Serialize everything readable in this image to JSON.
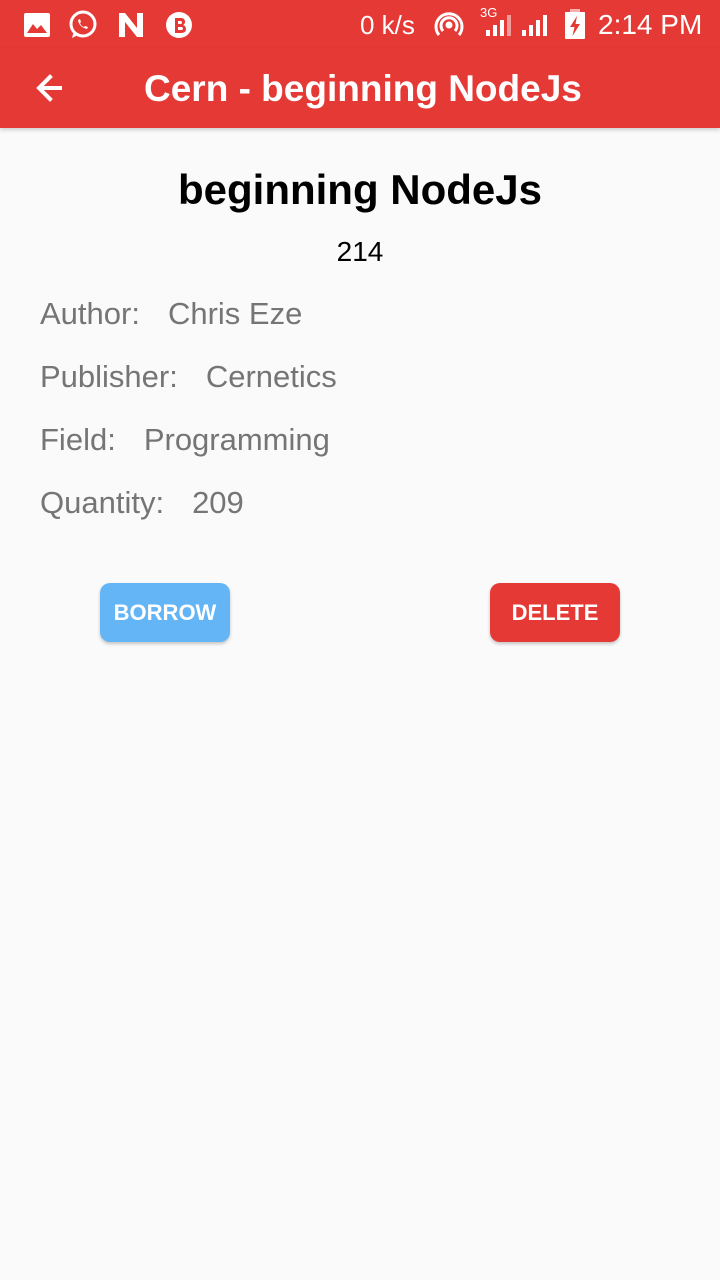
{
  "status_bar": {
    "net_speed": "0 k/s",
    "network_type": "3G",
    "time": "2:14 PM",
    "icons": [
      "gallery-icon",
      "whatsapp-icon",
      "n-app-icon",
      "b-app-icon",
      "hotspot-icon",
      "signal-icon",
      "signal-icon-2",
      "battery-charging-icon"
    ]
  },
  "app_bar": {
    "title": "Cern - beginning NodeJs",
    "back_icon": "arrow-left-icon"
  },
  "book": {
    "title": "beginning NodeJs",
    "id": "214",
    "author_label": "Author:",
    "author": "Chris Eze",
    "publisher_label": "Publisher:",
    "publisher": "Cernetics",
    "field_label": "Field:",
    "field": "Programming",
    "quantity_label": "Quantity:",
    "quantity": "209"
  },
  "actions": {
    "borrow_label": "BORROW",
    "delete_label": "DELETE"
  },
  "colors": {
    "primary": "#e53935",
    "borrow": "#64b5f6",
    "text_secondary": "#757575",
    "background": "#fafafa"
  }
}
